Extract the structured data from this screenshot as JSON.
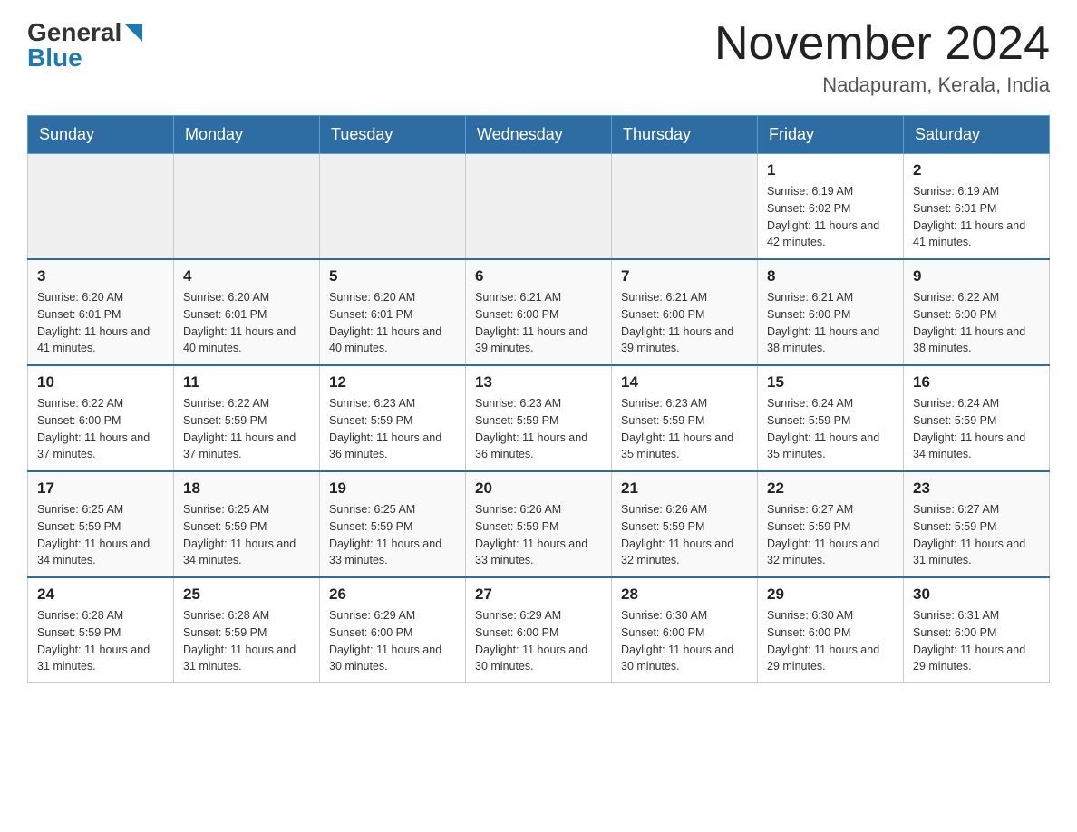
{
  "header": {
    "logo_general": "General",
    "logo_blue": "Blue",
    "month_year": "November 2024",
    "location": "Nadapuram, Kerala, India"
  },
  "days_of_week": [
    "Sunday",
    "Monday",
    "Tuesday",
    "Wednesday",
    "Thursday",
    "Friday",
    "Saturday"
  ],
  "weeks": [
    [
      {
        "day": "",
        "info": ""
      },
      {
        "day": "",
        "info": ""
      },
      {
        "day": "",
        "info": ""
      },
      {
        "day": "",
        "info": ""
      },
      {
        "day": "",
        "info": ""
      },
      {
        "day": "1",
        "info": "Sunrise: 6:19 AM\nSunset: 6:02 PM\nDaylight: 11 hours and 42 minutes."
      },
      {
        "day": "2",
        "info": "Sunrise: 6:19 AM\nSunset: 6:01 PM\nDaylight: 11 hours and 41 minutes."
      }
    ],
    [
      {
        "day": "3",
        "info": "Sunrise: 6:20 AM\nSunset: 6:01 PM\nDaylight: 11 hours and 41 minutes."
      },
      {
        "day": "4",
        "info": "Sunrise: 6:20 AM\nSunset: 6:01 PM\nDaylight: 11 hours and 40 minutes."
      },
      {
        "day": "5",
        "info": "Sunrise: 6:20 AM\nSunset: 6:01 PM\nDaylight: 11 hours and 40 minutes."
      },
      {
        "day": "6",
        "info": "Sunrise: 6:21 AM\nSunset: 6:00 PM\nDaylight: 11 hours and 39 minutes."
      },
      {
        "day": "7",
        "info": "Sunrise: 6:21 AM\nSunset: 6:00 PM\nDaylight: 11 hours and 39 minutes."
      },
      {
        "day": "8",
        "info": "Sunrise: 6:21 AM\nSunset: 6:00 PM\nDaylight: 11 hours and 38 minutes."
      },
      {
        "day": "9",
        "info": "Sunrise: 6:22 AM\nSunset: 6:00 PM\nDaylight: 11 hours and 38 minutes."
      }
    ],
    [
      {
        "day": "10",
        "info": "Sunrise: 6:22 AM\nSunset: 6:00 PM\nDaylight: 11 hours and 37 minutes."
      },
      {
        "day": "11",
        "info": "Sunrise: 6:22 AM\nSunset: 5:59 PM\nDaylight: 11 hours and 37 minutes."
      },
      {
        "day": "12",
        "info": "Sunrise: 6:23 AM\nSunset: 5:59 PM\nDaylight: 11 hours and 36 minutes."
      },
      {
        "day": "13",
        "info": "Sunrise: 6:23 AM\nSunset: 5:59 PM\nDaylight: 11 hours and 36 minutes."
      },
      {
        "day": "14",
        "info": "Sunrise: 6:23 AM\nSunset: 5:59 PM\nDaylight: 11 hours and 35 minutes."
      },
      {
        "day": "15",
        "info": "Sunrise: 6:24 AM\nSunset: 5:59 PM\nDaylight: 11 hours and 35 minutes."
      },
      {
        "day": "16",
        "info": "Sunrise: 6:24 AM\nSunset: 5:59 PM\nDaylight: 11 hours and 34 minutes."
      }
    ],
    [
      {
        "day": "17",
        "info": "Sunrise: 6:25 AM\nSunset: 5:59 PM\nDaylight: 11 hours and 34 minutes."
      },
      {
        "day": "18",
        "info": "Sunrise: 6:25 AM\nSunset: 5:59 PM\nDaylight: 11 hours and 34 minutes."
      },
      {
        "day": "19",
        "info": "Sunrise: 6:25 AM\nSunset: 5:59 PM\nDaylight: 11 hours and 33 minutes."
      },
      {
        "day": "20",
        "info": "Sunrise: 6:26 AM\nSunset: 5:59 PM\nDaylight: 11 hours and 33 minutes."
      },
      {
        "day": "21",
        "info": "Sunrise: 6:26 AM\nSunset: 5:59 PM\nDaylight: 11 hours and 32 minutes."
      },
      {
        "day": "22",
        "info": "Sunrise: 6:27 AM\nSunset: 5:59 PM\nDaylight: 11 hours and 32 minutes."
      },
      {
        "day": "23",
        "info": "Sunrise: 6:27 AM\nSunset: 5:59 PM\nDaylight: 11 hours and 31 minutes."
      }
    ],
    [
      {
        "day": "24",
        "info": "Sunrise: 6:28 AM\nSunset: 5:59 PM\nDaylight: 11 hours and 31 minutes."
      },
      {
        "day": "25",
        "info": "Sunrise: 6:28 AM\nSunset: 5:59 PM\nDaylight: 11 hours and 31 minutes."
      },
      {
        "day": "26",
        "info": "Sunrise: 6:29 AM\nSunset: 6:00 PM\nDaylight: 11 hours and 30 minutes."
      },
      {
        "day": "27",
        "info": "Sunrise: 6:29 AM\nSunset: 6:00 PM\nDaylight: 11 hours and 30 minutes."
      },
      {
        "day": "28",
        "info": "Sunrise: 6:30 AM\nSunset: 6:00 PM\nDaylight: 11 hours and 30 minutes."
      },
      {
        "day": "29",
        "info": "Sunrise: 6:30 AM\nSunset: 6:00 PM\nDaylight: 11 hours and 29 minutes."
      },
      {
        "day": "30",
        "info": "Sunrise: 6:31 AM\nSunset: 6:00 PM\nDaylight: 11 hours and 29 minutes."
      }
    ]
  ]
}
